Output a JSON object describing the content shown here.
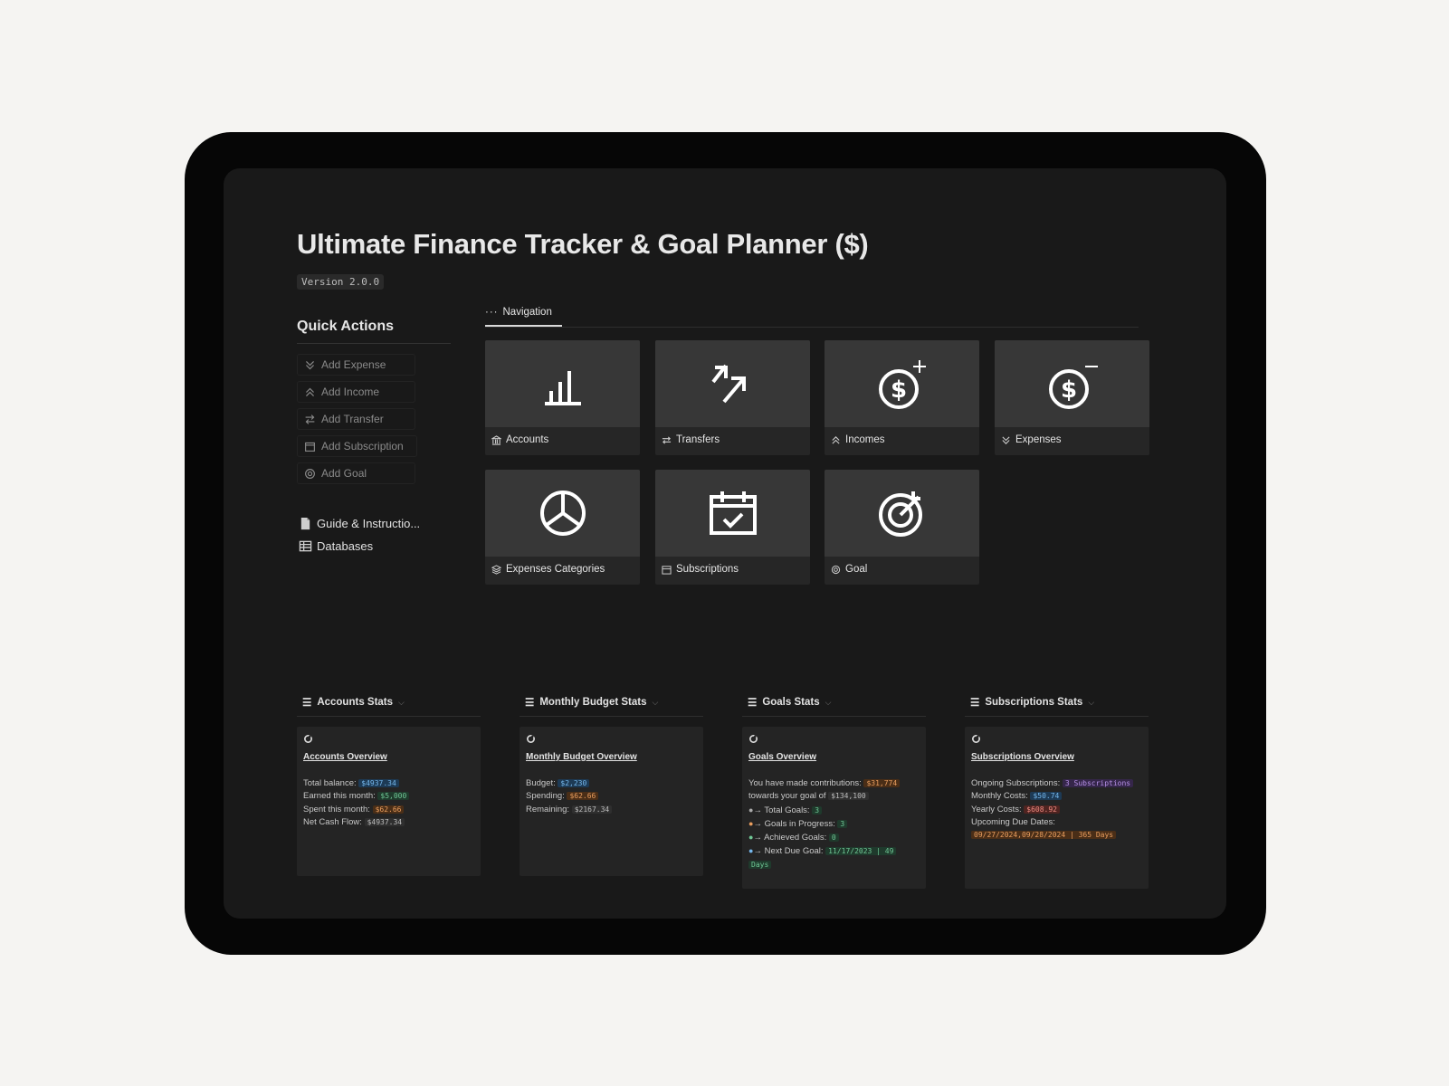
{
  "page": {
    "title": "Ultimate Finance Tracker & Goal Planner ($)",
    "version": "Version 2.0.0"
  },
  "quick_actions": {
    "title": "Quick Actions",
    "buttons": [
      "Add Expense",
      "Add Income",
      "Add Transfer",
      "Add Subscription",
      "Add Goal"
    ]
  },
  "links": {
    "guide": "Guide & Instructio...",
    "databases": "Databases"
  },
  "navigation": {
    "tab_label": "Navigation",
    "cards": [
      {
        "label": "Accounts",
        "icon": "bar-chart-icon"
      },
      {
        "label": "Transfers",
        "icon": "transfer-arrow-icon"
      },
      {
        "label": "Incomes",
        "icon": "dollar-plus-icon"
      },
      {
        "label": "Expenses",
        "icon": "dollar-minus-icon"
      },
      {
        "label": "Expenses Categories",
        "icon": "pie-chart-icon"
      },
      {
        "label": "Subscriptions",
        "icon": "calendar-check-icon"
      },
      {
        "label": "Goal",
        "icon": "target-icon"
      }
    ]
  },
  "stats": {
    "accounts": {
      "section": "Accounts Stats",
      "heading": "Accounts Overview",
      "total_balance_label": "Total balance:",
      "total_balance": "$4937.34",
      "earned_label": "Earned this month:",
      "earned": "$5,000",
      "spent_label": "Spent this month:",
      "spent": "$62.66",
      "net_label": "Net Cash Flow:",
      "net": "$4937.34"
    },
    "budget": {
      "section": "Monthly Budget Stats",
      "heading": "Monthly Budget Overview",
      "budget_label": "Budget:",
      "budget": "$2,230",
      "spending_label": "Spending:",
      "spending": "$62.66",
      "remaining_label": "Remaining:",
      "remaining": "$2167.34"
    },
    "goals": {
      "section": "Goals Stats",
      "heading": "Goals Overview",
      "contrib_label": "You have made contributions:",
      "contrib": "$31,774",
      "towards_label": "towards your goal of",
      "towards": "$134,100",
      "arrow": "→",
      "total_label": "Total Goals:",
      "total": "3",
      "progress_label": "Goals in Progress:",
      "progress": "3",
      "achieved_label": "Achieved Goals:",
      "achieved": "0",
      "next_label": "Next Due Goal:",
      "next_a": "11/17/2023 | 49",
      "next_b": "Days"
    },
    "subs": {
      "section": "Subscriptions Stats",
      "heading": "Subscriptions Overview",
      "ongoing_label": "Ongoing Subscriptions:",
      "ongoing": "3 Subscriptions",
      "monthly_label": "Monthly Costs:",
      "monthly": "$50.74",
      "yearly_label": "Yearly Costs:",
      "yearly": "$608.92",
      "due_label": "Upcoming Due Dates:",
      "due": "09/27/2024,09/28/2024 | 365 Days"
    }
  },
  "colors": {
    "background": "#f5f4f2",
    "tablet": "#060606",
    "screen": "#191919",
    "card_cover": "#373737",
    "blue": "#75b7ec",
    "green": "#6fc795",
    "orange": "#e89d5e",
    "red": "#ee8a80",
    "purple": "#b690e6"
  }
}
